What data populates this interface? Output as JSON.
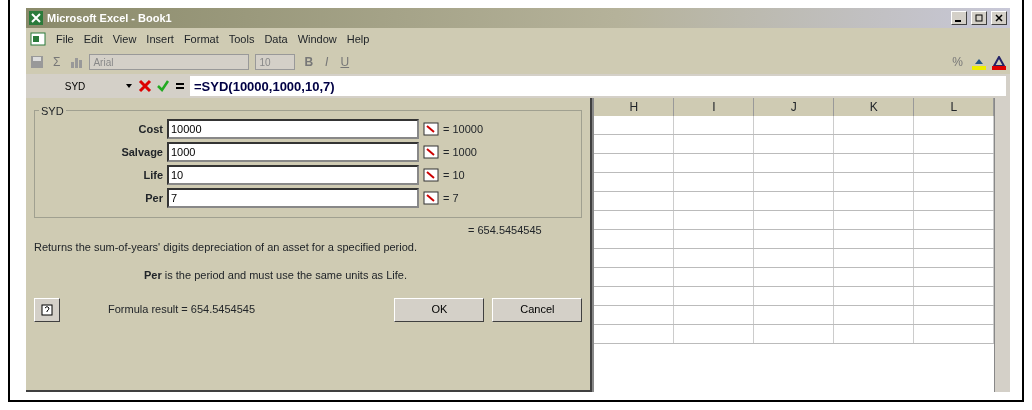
{
  "window": {
    "title": "Microsoft Excel - Book1"
  },
  "menu": [
    "File",
    "Edit",
    "View",
    "Insert",
    "Format",
    "Tools",
    "Data",
    "Window",
    "Help"
  ],
  "toolbar": {
    "sum": "Σ",
    "font": "Arial",
    "size": "10",
    "bold": "B",
    "italic": "I",
    "underline": "U",
    "percent": "%"
  },
  "formula_bar": {
    "name_box": "SYD",
    "formula": "=SYD(10000,1000,10,7)"
  },
  "dialog": {
    "group": "SYD",
    "args": [
      {
        "label": "Cost",
        "value": "10000",
        "result": "= 10000"
      },
      {
        "label": "Salvage",
        "value": "1000",
        "result": "= 1000"
      },
      {
        "label": "Life",
        "value": "10",
        "result": "= 10"
      },
      {
        "label": "Per",
        "value": "7",
        "result": "= 7"
      }
    ],
    "result": "= 654.5454545",
    "description": "Returns the sum-of-years' digits depreciation of an asset for a specified period.",
    "help_text": "**Per** is the period and must use the same units as Life.",
    "formula_result": "Formula result = 654.5454545",
    "buttons": [
      "OK",
      "Cancel"
    ]
  },
  "sheet": {
    "columns": [
      "H",
      "I",
      "J",
      "K",
      "L"
    ]
  }
}
